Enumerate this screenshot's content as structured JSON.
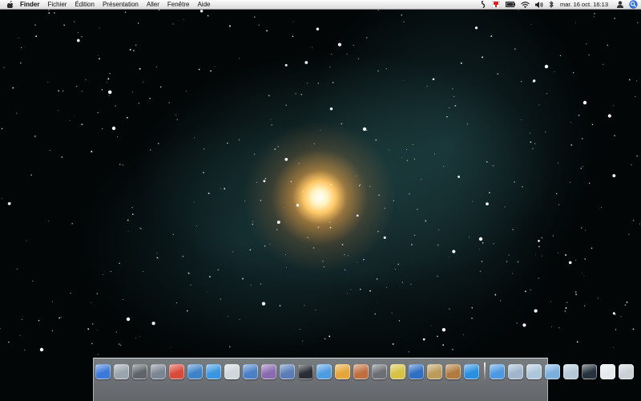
{
  "menubar": {
    "apple_icon": "apple-icon",
    "menus": [
      "Finder",
      "Fichier",
      "Édition",
      "Présentation",
      "Aller",
      "Fenêtre",
      "Aide"
    ],
    "status_icons": [
      "script-icon",
      "flag-icon",
      "battery-icon",
      "wifi-icon",
      "volume-icon",
      "bluetooth-icon"
    ],
    "clock": "mar. 16 oct. 16:13",
    "user_icon": "user-icon",
    "spotlight_icon": "spotlight-icon"
  },
  "dock": {
    "apps": [
      {
        "name": "finder",
        "color": "#3b78d8"
      },
      {
        "name": "dashboard",
        "color": "#9aa4ae"
      },
      {
        "name": "tools",
        "color": "#60646a"
      },
      {
        "name": "utilities",
        "color": "#7b8594"
      },
      {
        "name": "ical",
        "color": "#d84a3a"
      },
      {
        "name": "network",
        "color": "#3e82c8"
      },
      {
        "name": "safari",
        "color": "#3a96e0"
      },
      {
        "name": "textedit",
        "color": "#cfd6dc"
      },
      {
        "name": "preview",
        "color": "#4a80c4"
      },
      {
        "name": "pen",
        "color": "#8a6bb0"
      },
      {
        "name": "keynote",
        "color": "#5a7db8"
      },
      {
        "name": "black-app",
        "color": "#2a2e34"
      },
      {
        "name": "itunes",
        "color": "#4f9be0"
      },
      {
        "name": "iphoto",
        "color": "#e4a63a"
      },
      {
        "name": "photos",
        "color": "#c07040"
      },
      {
        "name": "gear",
        "color": "#6c6f74"
      },
      {
        "name": "yellow-app",
        "color": "#d6c244"
      },
      {
        "name": "blue-app",
        "color": "#2f6ec0"
      },
      {
        "name": "pencil",
        "color": "#b99c5c"
      },
      {
        "name": "planet",
        "color": "#b07a40"
      },
      {
        "name": "quicktime",
        "color": "#2a8fe0"
      }
    ],
    "stacks": [
      {
        "name": "doc-1",
        "color": "#4d98e0"
      },
      {
        "name": "doc-2",
        "color": "#9fb5cc"
      },
      {
        "name": "doc-3",
        "color": "#aec6da"
      },
      {
        "name": "doc-4",
        "color": "#7cb0dc"
      },
      {
        "name": "doc-5",
        "color": "#b6c8d8"
      },
      {
        "name": "screen",
        "color": "#26323e"
      },
      {
        "name": "doc-6",
        "color": "#e6eaee"
      },
      {
        "name": "trash",
        "color": "#c9d0d6"
      }
    ]
  }
}
